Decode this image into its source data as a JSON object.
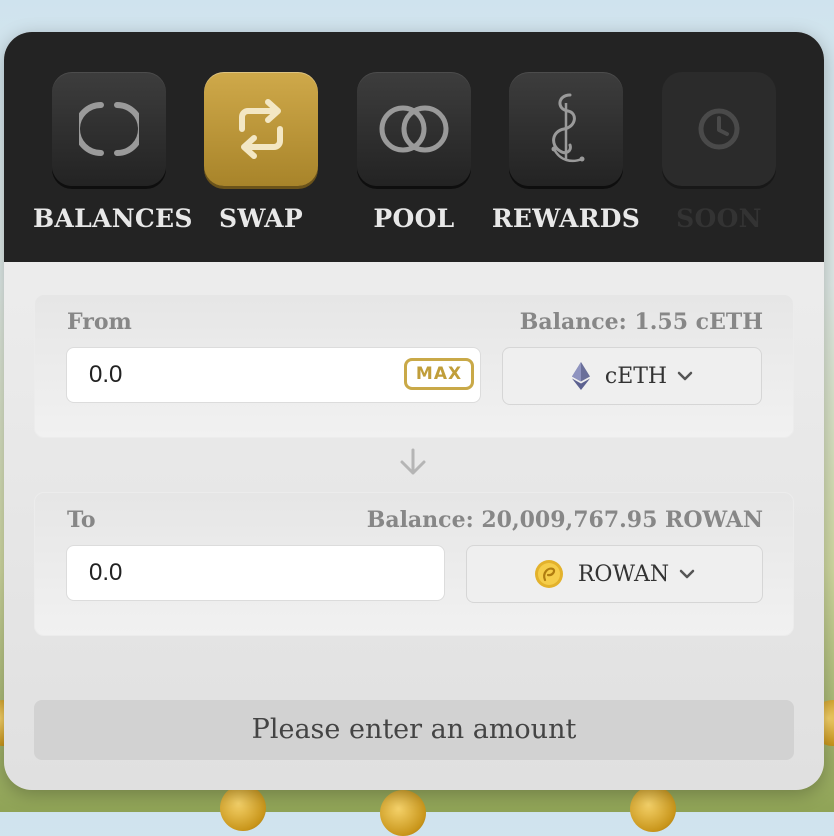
{
  "nav": {
    "items": [
      {
        "label": "BALANCES",
        "icon": "balances-icon"
      },
      {
        "label": "SWAP",
        "icon": "swap-icon",
        "active": true
      },
      {
        "label": "POOL",
        "icon": "pool-icon"
      },
      {
        "label": "REWARDS",
        "icon": "rewards-icon"
      },
      {
        "label": "SOON",
        "icon": "clock-icon",
        "disabled": true
      }
    ]
  },
  "from": {
    "label": "From",
    "balance": "Balance: 1.55 cETH",
    "amount": "0.0",
    "max_label": "MAX",
    "token": "cETH",
    "token_icon": "ethereum-icon"
  },
  "to": {
    "label": "To",
    "balance": "Balance: 20,009,767.95 ROWAN",
    "amount": "0.0",
    "token": "ROWAN",
    "token_icon": "rowan-coin-icon"
  },
  "submit_label": "Please enter an amount",
  "colors": {
    "accent": "#c9a948",
    "nav_bg": "#232323",
    "active_btn": "#bf9a3c"
  }
}
